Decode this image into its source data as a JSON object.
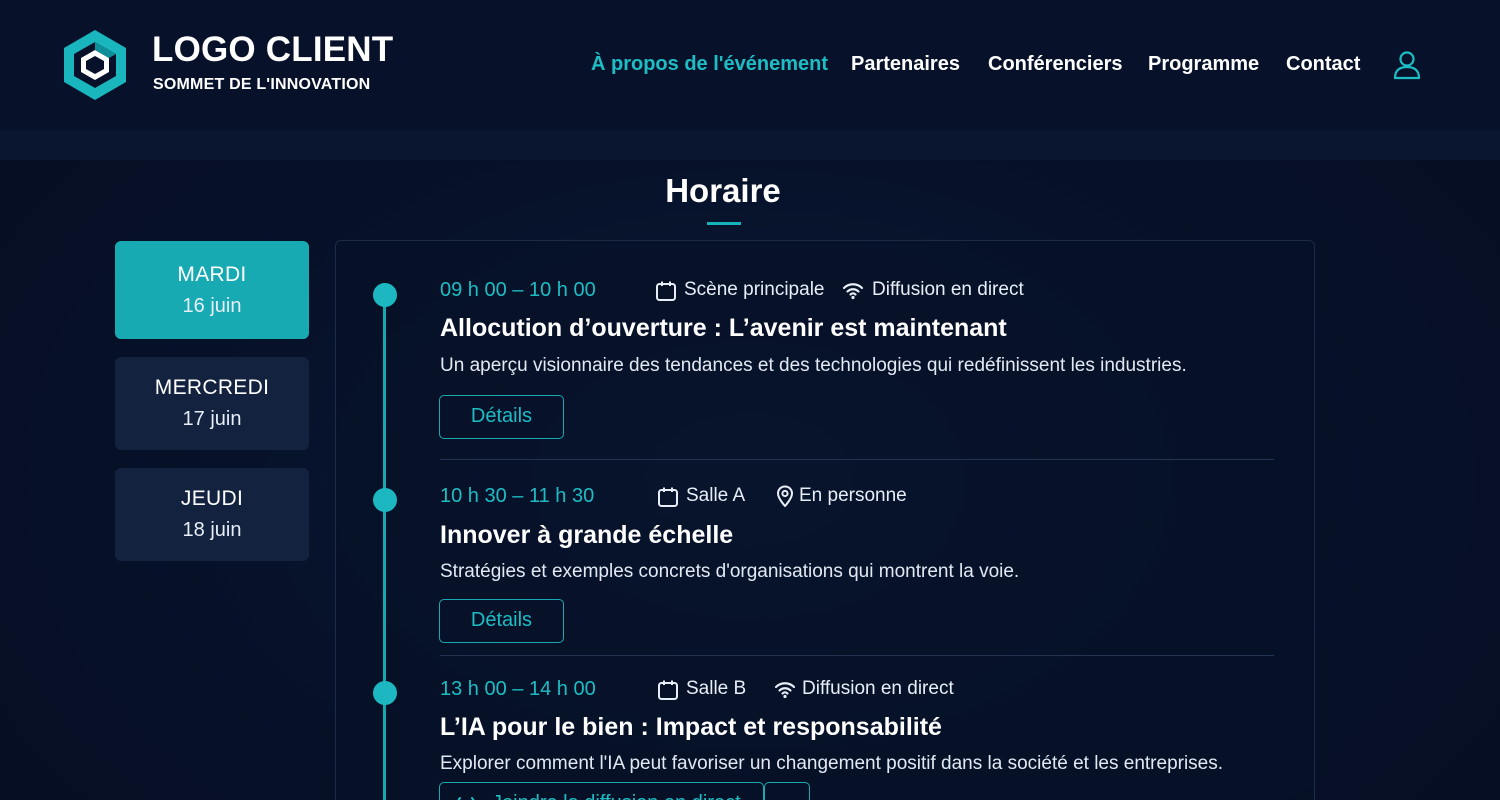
{
  "brand": {
    "title": "LOGO CLIENT",
    "subtitle": "SOMMET DE L'INNOVATION"
  },
  "nav": {
    "items": [
      {
        "label": "À propos de l'événement",
        "active": true
      },
      {
        "label": "Partenaires",
        "active": false
      },
      {
        "label": "Conférenciers",
        "active": false
      },
      {
        "label": "Programme",
        "active": false
      },
      {
        "label": "Contact",
        "active": false
      }
    ],
    "user_icon": "user-icon"
  },
  "schedule": {
    "title": "Horaire",
    "days": [
      {
        "name": "MARDI",
        "date": "16 juin",
        "active": true
      },
      {
        "name": "MERCREDI",
        "date": "17 juin",
        "active": false
      },
      {
        "name": "JEUDI",
        "date": "18 juin",
        "active": false
      }
    ],
    "sessions": [
      {
        "time": "09 h 00 – 10 h 00",
        "room": "Scène principale",
        "mode": "Diffusion en direct",
        "mode_icon": "wifi-icon",
        "title": "Allocution d’ouverture : L’avenir est maintenant",
        "description": "Un aperçu visionnaire des tendances et des technologies qui redéfinissent les industries.",
        "button": "Détails"
      },
      {
        "time": "10 h 30 – 11 h 30",
        "room": "Salle A",
        "mode": "En personne",
        "mode_icon": "location-pin-icon",
        "title": "Innover à grande échelle",
        "description": "Stratégies et exemples concrets d'organisations qui montrent la voie.",
        "button": "Détails"
      },
      {
        "time": "13 h 00 – 14 h 00",
        "room": "Salle B",
        "mode": "Diffusion en direct",
        "mode_icon": "wifi-icon",
        "title": "L’IA pour le bien : Impact et responsabilité",
        "description": "Explorer comment l'IA peut favoriser un changement positif dans la société et les entreprises.",
        "button": "Joindre la diffusion en direct"
      }
    ]
  },
  "colors": {
    "accent": "#1dbdc4",
    "background": "#061027",
    "panel_border": "#1c2b48"
  }
}
